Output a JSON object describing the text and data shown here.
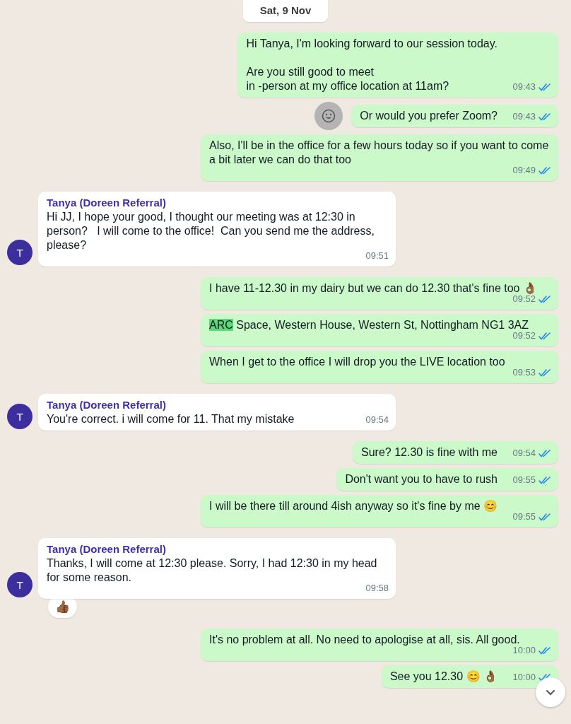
{
  "date_chip": "Sat, 9 Nov",
  "messages": [
    {
      "kind": "out",
      "text": "Hi Tanya, I'm looking forward to our session today.\n\nAre you still good to meet\nin -person at my office location at 11am?",
      "time": "09:43",
      "read": true
    },
    {
      "kind": "out",
      "text": "Or would you prefer Zoom?",
      "time": "09:43",
      "read": true,
      "emoji_button": true
    },
    {
      "kind": "out",
      "text": "Also, I'll be in the office for a few hours today so if you want to come a bit later we can do that too",
      "time": "09:49",
      "read": true
    },
    {
      "kind": "in",
      "sender": "Tanya (Doreen Referral)",
      "avatar": "T",
      "text": "Hi JJ, I hope your good, I thought our meeting was at 12:30 in person?   I will come to the office!  Can you send me the address, please?",
      "time": "09:51"
    },
    {
      "kind": "out",
      "text": "I have 11-12.30 in my dairy but we can do 12.30 that's fine too 👌🏾",
      "time": "09:52",
      "read": true
    },
    {
      "kind": "out",
      "highlight": "ARC",
      "text": " Space, Western House, Western St, Nottingham NG1 3AZ",
      "time": "09:52",
      "read": true
    },
    {
      "kind": "out",
      "text": "When I get to the office I will drop you the LIVE location too",
      "time": "09:53",
      "read": true
    },
    {
      "kind": "in",
      "sender": "Tanya (Doreen Referral)",
      "avatar": "T",
      "text": "You're correct. i will come for 11. That my mistake",
      "time": "09:54"
    },
    {
      "kind": "out",
      "text": "Sure? 12.30 is fine with me",
      "time": "09:54",
      "read": true
    },
    {
      "kind": "out",
      "text": "Don't want you to have to rush",
      "time": "09:55",
      "read": true
    },
    {
      "kind": "out",
      "text": "I will be there till around 4ish anyway so it's fine by me 😊",
      "time": "09:55",
      "read": true
    },
    {
      "kind": "in",
      "sender": "Tanya (Doreen Referral)",
      "avatar": "T",
      "text": "Thanks, I will come at 12:30 please. Sorry, I had 12:30 in my head for some reason.",
      "time": "09:58",
      "reaction": "👍🏾"
    },
    {
      "kind": "out",
      "text": "It's no problem at all. No need to apologise at all, sis. All good.",
      "time": "10:00",
      "read": true
    },
    {
      "kind": "out",
      "text": "See you 12.30 😊 👌🏾",
      "time": "10:00",
      "read": true
    }
  ]
}
